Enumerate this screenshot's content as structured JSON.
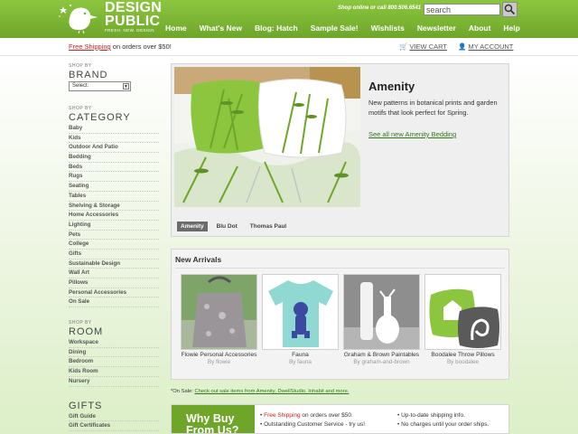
{
  "header": {
    "logo_line1": "DESIGN",
    "logo_line2": "PUBLIC",
    "logo_tagline": "FRESH. NEW. DESIGN",
    "shop_online": "Shop online or call 800.506.6541",
    "search_value": "search",
    "nav": [
      "Home",
      "What's New",
      "Blog: Hatch",
      "Sample Sale!",
      "Wishlists",
      "Newsletter",
      "About",
      "Help"
    ]
  },
  "subbar": {
    "free_shipping": "Free Shipping",
    "free_shipping_rest": " on orders over $50!",
    "view_cart": "VIEW CART",
    "my_account": "MY ACCOUNT"
  },
  "sidebar": {
    "shop_by": "SHOP BY",
    "brand_title": "BRAND",
    "brand_select": "Select:",
    "category_title": "CATEGORY",
    "categories": [
      "Baby",
      "Kids",
      "Outdoor And Patio",
      "Bedding",
      "Beds",
      "Rugs",
      "Seating",
      "Tables",
      "Shelving & Storage",
      "Home Accessories",
      "Lighting",
      "Pets",
      "College",
      "Gifts",
      "Sustainable Design",
      "Wall Art",
      "Pillows",
      "Personal Accessories",
      "On Sale"
    ],
    "room_title": "ROOM",
    "rooms": [
      "Workspace",
      "Dining",
      "Bedroom",
      "Kids Room",
      "Nursery"
    ],
    "gifts_title": "GIFTS",
    "gifts": [
      "Gift Guide",
      "Gift Certificates"
    ]
  },
  "feature": {
    "title": "Amenity",
    "description": "New patterns in botanical prints and garden motifs that look perfect for Spring.",
    "link": "See all new Amenity Bedding",
    "tabs": [
      "Amenity",
      "Blu Dot",
      "Thomas Paul"
    ],
    "active_tab": "Amenity"
  },
  "arrivals": {
    "title": "New Arrivals",
    "products": [
      {
        "name": "Flowie Personal Accessories",
        "by": "By flowie"
      },
      {
        "name": "Fauna",
        "by": "By fauna"
      },
      {
        "name": "Graham & Brown Paintables",
        "by": "By graham-and-brown"
      },
      {
        "name": "Boodalee Throw Pillows",
        "by": "By boodalee"
      }
    ]
  },
  "onsale": {
    "prefix": "*On Sale: ",
    "link": "Check out sale items from Amenity, DwellStudio, Inhabit and more."
  },
  "whybuy": {
    "badge_line1": "Why Buy",
    "badge_line2": "From Us?",
    "col1": [
      "Free Shipping",
      " on orders over $50.",
      "• Outstanding Customer Service - try us!"
    ],
    "col2": [
      "• Up-to-date shipping info.",
      "• No charges until your order ships."
    ]
  },
  "colors": {
    "brand_green": "#7ab534",
    "link_green": "#2e7a17",
    "accent_red": "#cc2222"
  }
}
